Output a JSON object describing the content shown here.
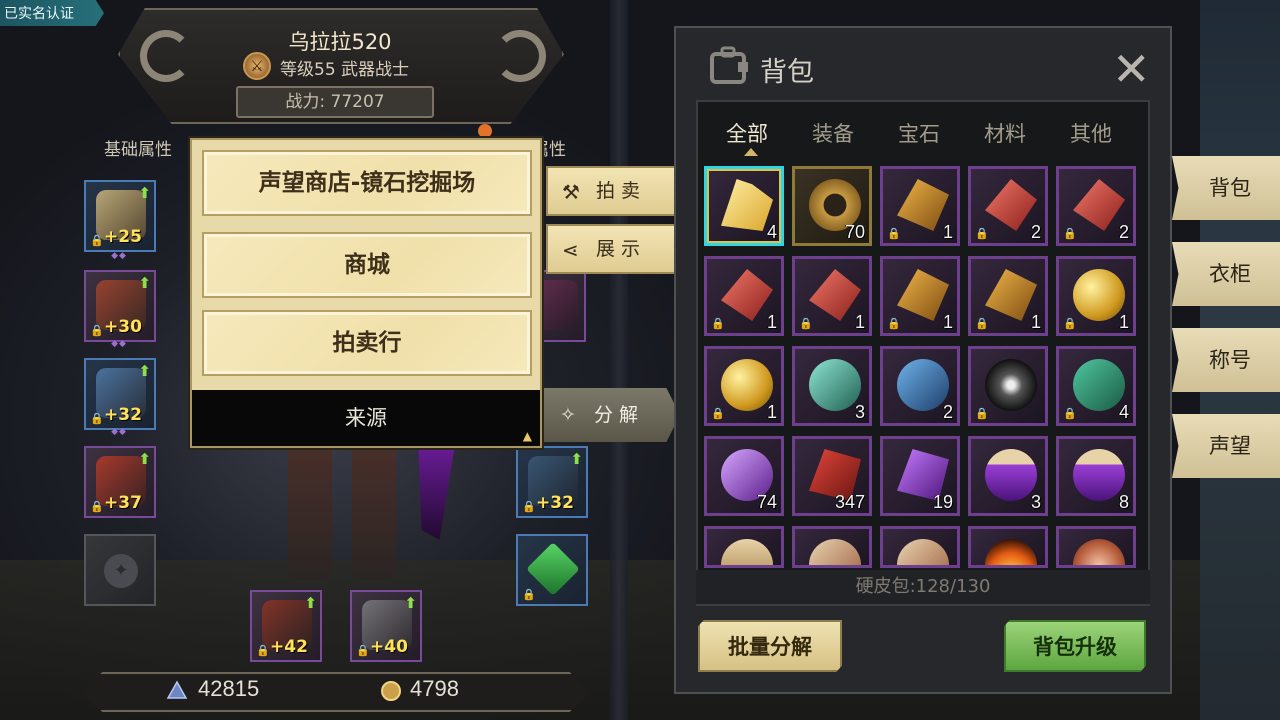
{
  "realname_badge": "已实名认证",
  "character": {
    "name": "乌拉拉520",
    "level_class": "等级55 武器战士",
    "power": "战力: 77207"
  },
  "stat_tabs": {
    "basic": "基础属性",
    "advanced": "属性"
  },
  "equipment": {
    "left": [
      {
        "plus": "+25",
        "quality": "blue"
      },
      {
        "plus": "+30",
        "quality": "purple"
      },
      {
        "plus": "+32",
        "quality": "blue"
      },
      {
        "plus": "+37",
        "quality": "purple"
      }
    ],
    "right": [
      {
        "plus": "+32",
        "quality": "blue"
      }
    ],
    "bottom": [
      {
        "plus": "+42",
        "quality": "purple"
      },
      {
        "plus": "+40",
        "quality": "purple"
      }
    ]
  },
  "currency": {
    "crystal": "42815",
    "gold": "4798"
  },
  "source_popup": {
    "options": [
      "声望商店-镜石挖掘场",
      "商城",
      "拍卖行"
    ],
    "footer": "来源"
  },
  "actions": {
    "auction": "拍卖",
    "show": "展示",
    "decompose": "分解"
  },
  "bag": {
    "title": "背包",
    "tabs": [
      "全部",
      "装备",
      "宝石",
      "材料",
      "其他"
    ],
    "active_tab": "全部",
    "capacity": "硬皮包:128/130",
    "batch_decompose": "批量分解",
    "upgrade": "背包升级",
    "items": [
      {
        "qty": "4",
        "icon": "gold-crystal",
        "locked": false,
        "border": "selected"
      },
      {
        "qty": "70",
        "icon": "gold-ring",
        "locked": false,
        "border": "gold"
      },
      {
        "qty": "1",
        "icon": "amber-gem",
        "locked": true,
        "border": "purple"
      },
      {
        "qty": "2",
        "icon": "red-gem",
        "locked": true,
        "border": "purple"
      },
      {
        "qty": "2",
        "icon": "red-gem",
        "locked": true,
        "border": "purple"
      },
      {
        "qty": "1",
        "icon": "red-gem",
        "locked": true,
        "border": "purple"
      },
      {
        "qty": "1",
        "icon": "red-gem",
        "locked": true,
        "border": "purple"
      },
      {
        "qty": "1",
        "icon": "amber-gem",
        "locked": true,
        "border": "purple"
      },
      {
        "qty": "1",
        "icon": "amber-gem",
        "locked": true,
        "border": "purple"
      },
      {
        "qty": "1",
        "icon": "gold-orb",
        "locked": true,
        "border": "purple"
      },
      {
        "qty": "1",
        "icon": "gold-orb",
        "locked": true,
        "border": "purple"
      },
      {
        "qty": "3",
        "icon": "teal-crystal",
        "locked": false,
        "border": "purple"
      },
      {
        "qty": "2",
        "icon": "blue-beast",
        "locked": false,
        "border": "purple"
      },
      {
        "qty": "",
        "icon": "dark-orb",
        "locked": true,
        "border": "purple"
      },
      {
        "qty": "4",
        "icon": "green-bag",
        "locked": true,
        "border": "purple"
      },
      {
        "qty": "74",
        "icon": "purple-crystal",
        "locked": false,
        "border": "purple"
      },
      {
        "qty": "347",
        "icon": "red-rune",
        "locked": false,
        "border": "purple"
      },
      {
        "qty": "19",
        "icon": "purple-rune",
        "locked": false,
        "border": "purple"
      },
      {
        "qty": "3",
        "icon": "purple-potion",
        "locked": false,
        "border": "purple"
      },
      {
        "qty": "8",
        "icon": "purple-potion",
        "locked": false,
        "border": "purple"
      },
      {
        "qty": "",
        "icon": "potion-bottle",
        "locked": false,
        "border": "purple"
      },
      {
        "qty": "",
        "icon": "scroll",
        "locked": false,
        "border": "purple"
      },
      {
        "qty": "",
        "icon": "scroll",
        "locked": false,
        "border": "purple"
      },
      {
        "qty": "",
        "icon": "fire",
        "locked": false,
        "border": "purple"
      },
      {
        "qty": "",
        "icon": "rune-stone",
        "locked": false,
        "border": "purple"
      }
    ]
  },
  "side_nav": [
    "背包",
    "衣柜",
    "称号",
    "声望"
  ],
  "colors": {
    "popup_bg": "#e8d9a8",
    "purple_border": "#6d3f8c",
    "gold_border": "#8f7a3a",
    "selected_border": "#2fd6e8",
    "upgrade_green": "#5ea63f"
  }
}
